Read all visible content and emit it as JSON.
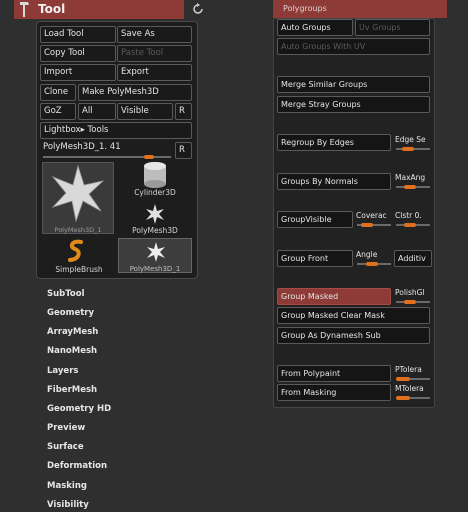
{
  "tool": {
    "title": "Tool",
    "buttons": {
      "load_tool": "Load Tool",
      "save_as": "Save As",
      "copy_tool": "Copy Tool",
      "paste_tool": "Paste Tool",
      "import": "Import",
      "export": "Export",
      "clone": "Clone",
      "make_polymesh": "Make PolyMesh3D",
      "goz": "GoZ",
      "all": "All",
      "visible": "Visible",
      "r": "R",
      "lightbox_tools": "Lightbox▸ Tools",
      "r2": "R"
    },
    "current_tool_label": "PolyMesh3D_1. 41",
    "thumbnails": {
      "big_label": "PolyMesh3D_1",
      "cylinder": "Cylinder3D",
      "polymesh": "PolyMesh3D",
      "simplebrush": "SimpleBrush",
      "polymesh_selected": "PolyMesh3D_1"
    }
  },
  "menu": [
    "SubTool",
    "Geometry",
    "ArrayMesh",
    "NanoMesh",
    "Layers",
    "FiberMesh",
    "Geometry HD",
    "Preview",
    "Surface",
    "Deformation",
    "Masking",
    "Visibility"
  ],
  "polygroups": {
    "title": "Polygroups",
    "auto_groups": "Auto Groups",
    "uv_groups": "Uv Groups",
    "auto_groups_with_uv": "Auto Groups With UV",
    "merge_similar": "Merge Similar Groups",
    "merge_stray": "Merge Stray Groups",
    "regroup_by_edges": "Regroup By Edges",
    "edge_s": "Edge Se",
    "groups_by_normals": "Groups By Normals",
    "maxang": "MaxAng",
    "groupvisible": "GroupVisible",
    "coverage": "Coverac",
    "clstr": "Clstr 0.",
    "group_front": "Group Front",
    "angle": "Angle",
    "additive": "Additiv",
    "group_masked": "Group Masked",
    "polishgr": "PolishGl",
    "group_masked_clear": "Group Masked Clear Mask",
    "group_as_dynamesh": "Group As Dynamesh Sub",
    "from_polypaint": "From Polypaint",
    "ptolera": "PTolera",
    "from_masking": "From Masking",
    "mtolera": "MTolera"
  },
  "colors": {
    "accent": "#e07020",
    "header": "#8e3b38"
  }
}
